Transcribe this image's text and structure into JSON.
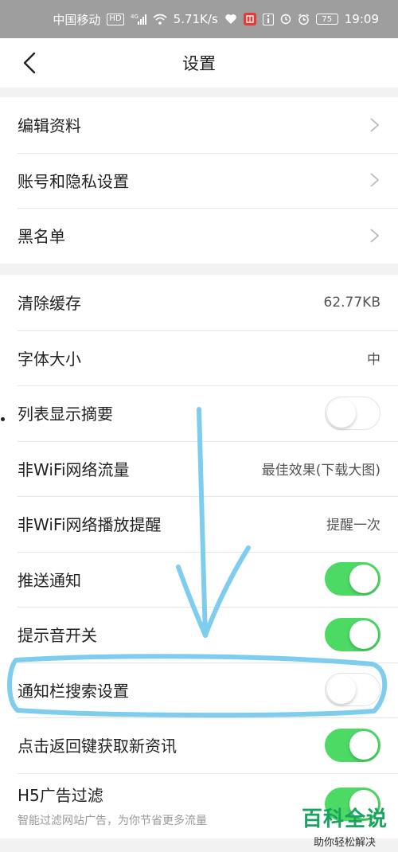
{
  "status_bar": {
    "carrier": "中国移动",
    "hd_badge": "HD",
    "network_type": "4G",
    "speed": "5.71K/s",
    "battery": "75",
    "time": "19:09"
  },
  "header": {
    "title": "设置",
    "back_icon": "chevron-left-icon"
  },
  "group1": [
    {
      "label": "编辑资料",
      "trailing": "chevron"
    },
    {
      "label": "账号和隐私设置",
      "trailing": "chevron"
    },
    {
      "label": "黑名单",
      "trailing": "chevron"
    }
  ],
  "group2": [
    {
      "label": "清除缓存",
      "value": "62.77KB"
    },
    {
      "label": "字体大小",
      "value": "中"
    },
    {
      "label": "列表显示摘要",
      "toggle": false
    },
    {
      "label": "非WiFi网络流量",
      "value": "最佳效果(下载大图)"
    },
    {
      "label": "非WiFi网络播放提醒",
      "value": "提醒一次"
    },
    {
      "label": "推送通知",
      "toggle": true
    },
    {
      "label": "提示音开关",
      "toggle": true
    },
    {
      "label": "通知栏搜索设置",
      "toggle": false
    },
    {
      "label": "点击返回键获取新资讯",
      "toggle": true
    },
    {
      "label": "H5广告过滤",
      "sublabel": "智能过滤网站广告，为你节省更多流量",
      "toggle": true
    }
  ],
  "colors": {
    "toggle_on": "#4cd964",
    "annotation": "#7fcdee",
    "watermark": "#1aa260"
  },
  "watermark": {
    "main": "百科全说",
    "sub": "助你轻松解决"
  }
}
